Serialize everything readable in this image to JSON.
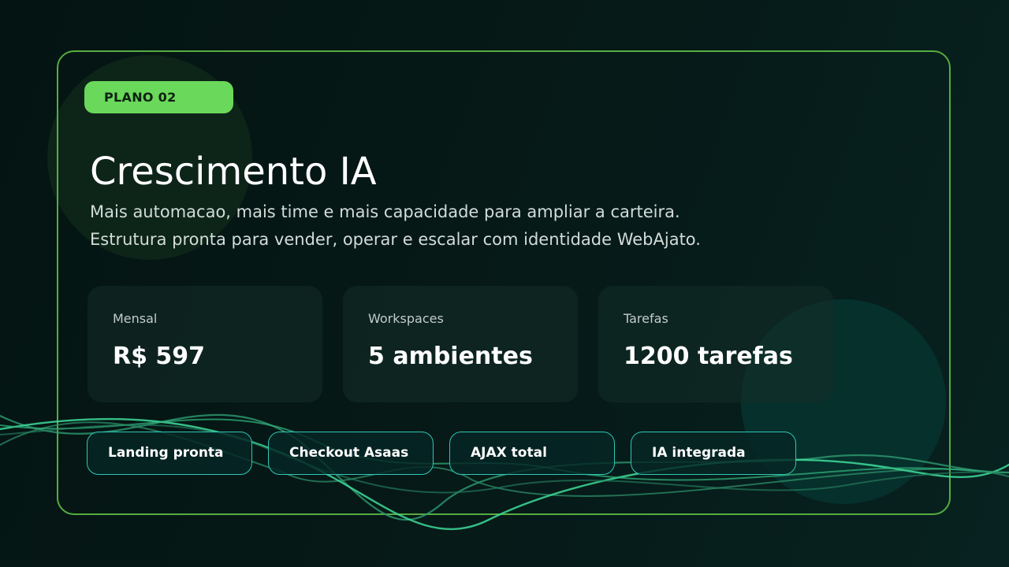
{
  "plan": {
    "badge": "PLANO 02",
    "title": "Crescimento IA",
    "subtitle_lines": [
      "Mais automacao, mais time e mais capacidade para ampliar a carteira.",
      "Estrutura pronta para vender, operar e escalar com identidade WebAjato."
    ]
  },
  "stats": [
    {
      "label": "Mensal",
      "value": "R$ 597"
    },
    {
      "label": "Workspaces",
      "value": "5 ambientes"
    },
    {
      "label": "Tarefas",
      "value": "1200 tarefas"
    }
  ],
  "features": [
    "Landing pronta",
    "Checkout Asaas",
    "AJAX total",
    "IA integrada"
  ],
  "colors": {
    "accent": "#6ad85a",
    "border": "#55ad3f",
    "chip_border": "#2fc7b5",
    "wave": "#3fdc9a",
    "background": "#041412"
  }
}
